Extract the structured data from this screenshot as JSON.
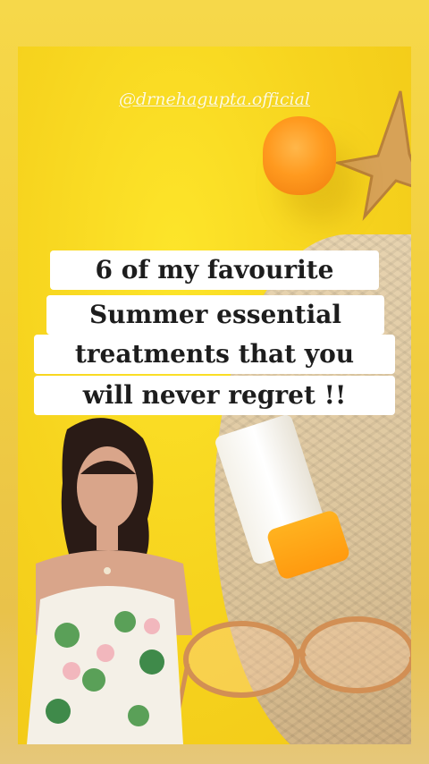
{
  "story": {
    "handle": "@drnehagupta.official",
    "headline_lines": [
      "6 of my favourite",
      "Summer essential",
      "treatments that you",
      "will never regret !!"
    ]
  },
  "colors": {
    "background": "#f6d84a",
    "caption_box": "#ffffff",
    "caption_text": "#1d1d1d",
    "accent_orange": "#ff9a1f"
  },
  "icons": [
    "sunscreen-cap-icon",
    "starfish-icon",
    "straw-hat-icon",
    "sunglasses-icon",
    "sunscreen-tube-icon"
  ]
}
